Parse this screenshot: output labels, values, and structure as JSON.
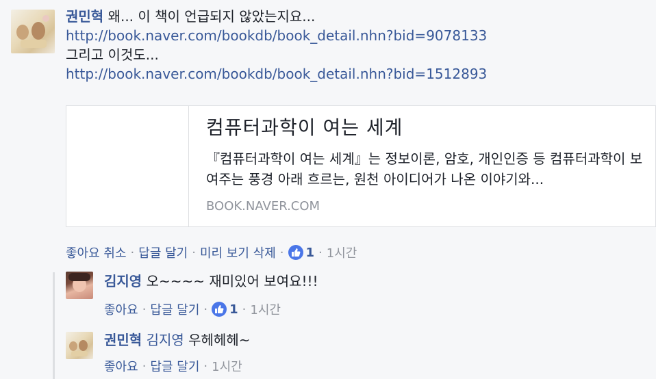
{
  "comment": {
    "author": "권민혁",
    "text": "왜... 이 책이 언급되지 않았는지요...",
    "link1": "http://book.naver.com/bookdb/book_detail.nhn?bid=9078133",
    "text2": "그리고 이것도...",
    "link2": "http://book.naver.com/bookdb/book_detail.nhn?bid=1512893",
    "preview": {
      "title": "컴퓨터과학이 여는 세계",
      "description": "『컴퓨터과학이 여는 세계』는 정보이론, 암호, 개인인증 등 컴퓨터과학이 보여주는 풍경 아래 흐르는, 원천 아이디어가 나온 이야기와...",
      "domain": "BOOK.NAVER.COM"
    },
    "actions": {
      "unlike": "좋아요 취소",
      "reply": "답글 달기",
      "remove_preview": "미리 보기 삭제",
      "like_count": "1",
      "time": "1시간"
    }
  },
  "replies": [
    {
      "author": "김지영",
      "text": "오~~~~ 재미있어 보여요!!!",
      "actions": {
        "like": "좋아요",
        "reply": "답글 달기",
        "like_count": "1",
        "time": "1시간"
      }
    },
    {
      "author": "권민혁",
      "mention": "김지영",
      "text": "우헤헤헤~",
      "actions": {
        "like": "좋아요",
        "reply": "답글 달기",
        "time": "1시간"
      }
    }
  ],
  "colors": {
    "link": "#385898",
    "meta": "#90949c",
    "like_blue": "#4a76e8"
  }
}
